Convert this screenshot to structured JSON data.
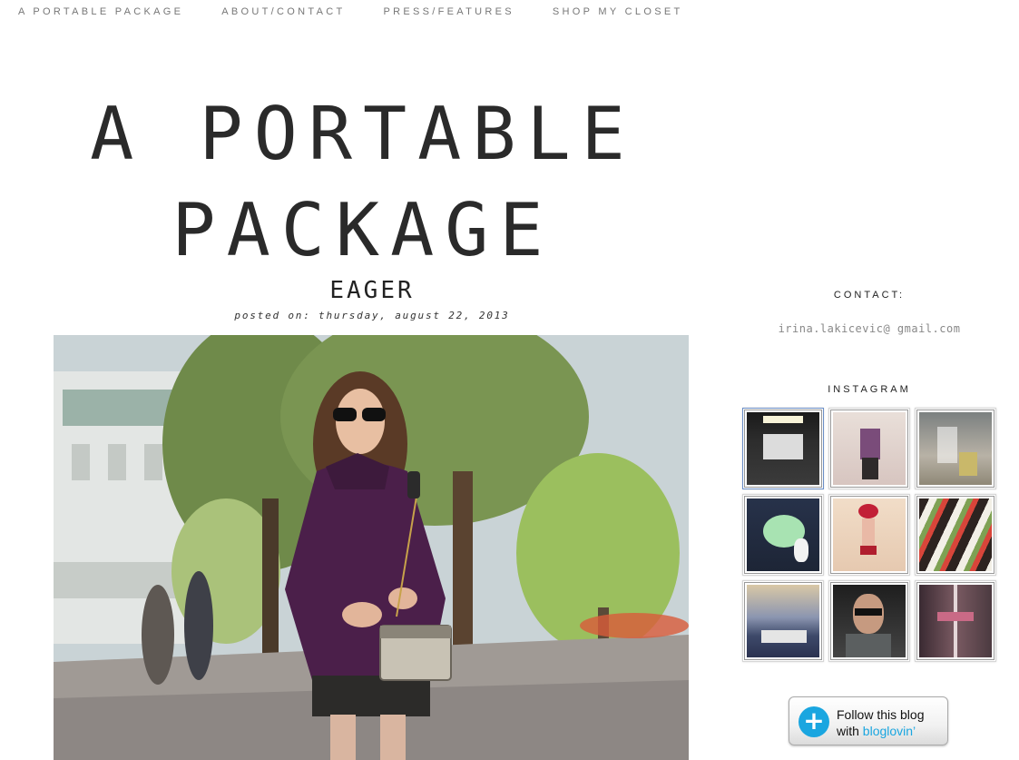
{
  "nav": {
    "items": [
      "A PORTABLE PACKAGE",
      "ABOUT/CONTACT",
      "PRESS/FEATURES",
      "SHOP MY CLOSET"
    ]
  },
  "masthead": {
    "line1": "A PORTABLE",
    "line2": "PACKAGE"
  },
  "post": {
    "title": "EAGER",
    "date": "posted on: thursday, august 22, 2013",
    "photo": "woman-in-purple-sweater-photo"
  },
  "sidebar": {
    "contact_heading": "CONTACT:",
    "contact_email": "irina.lakicevic@ gmail.com",
    "instagram_heading": "INSTAGRAM",
    "instagram_items": [
      "dark-doorway-photo",
      "woman-plaid-shirt-photo",
      "glasses-on-table-photo",
      "plush-bunny-photo",
      "woman-red-hat-photo",
      "sushi-platter-photo",
      "harbor-boats-photo",
      "woman-sunglasses-portrait-photo",
      "window-flowers-photo"
    ]
  },
  "bloglovin": {
    "icon": "plus-icon",
    "line1": "Follow this blog",
    "line2_prefix": "with ",
    "brand": "bloglovin’"
  },
  "colors": {
    "text": "#2a2a2a",
    "nav": "#777777",
    "email": "#888888",
    "bloglovin_blue": "#1aa6e0"
  }
}
